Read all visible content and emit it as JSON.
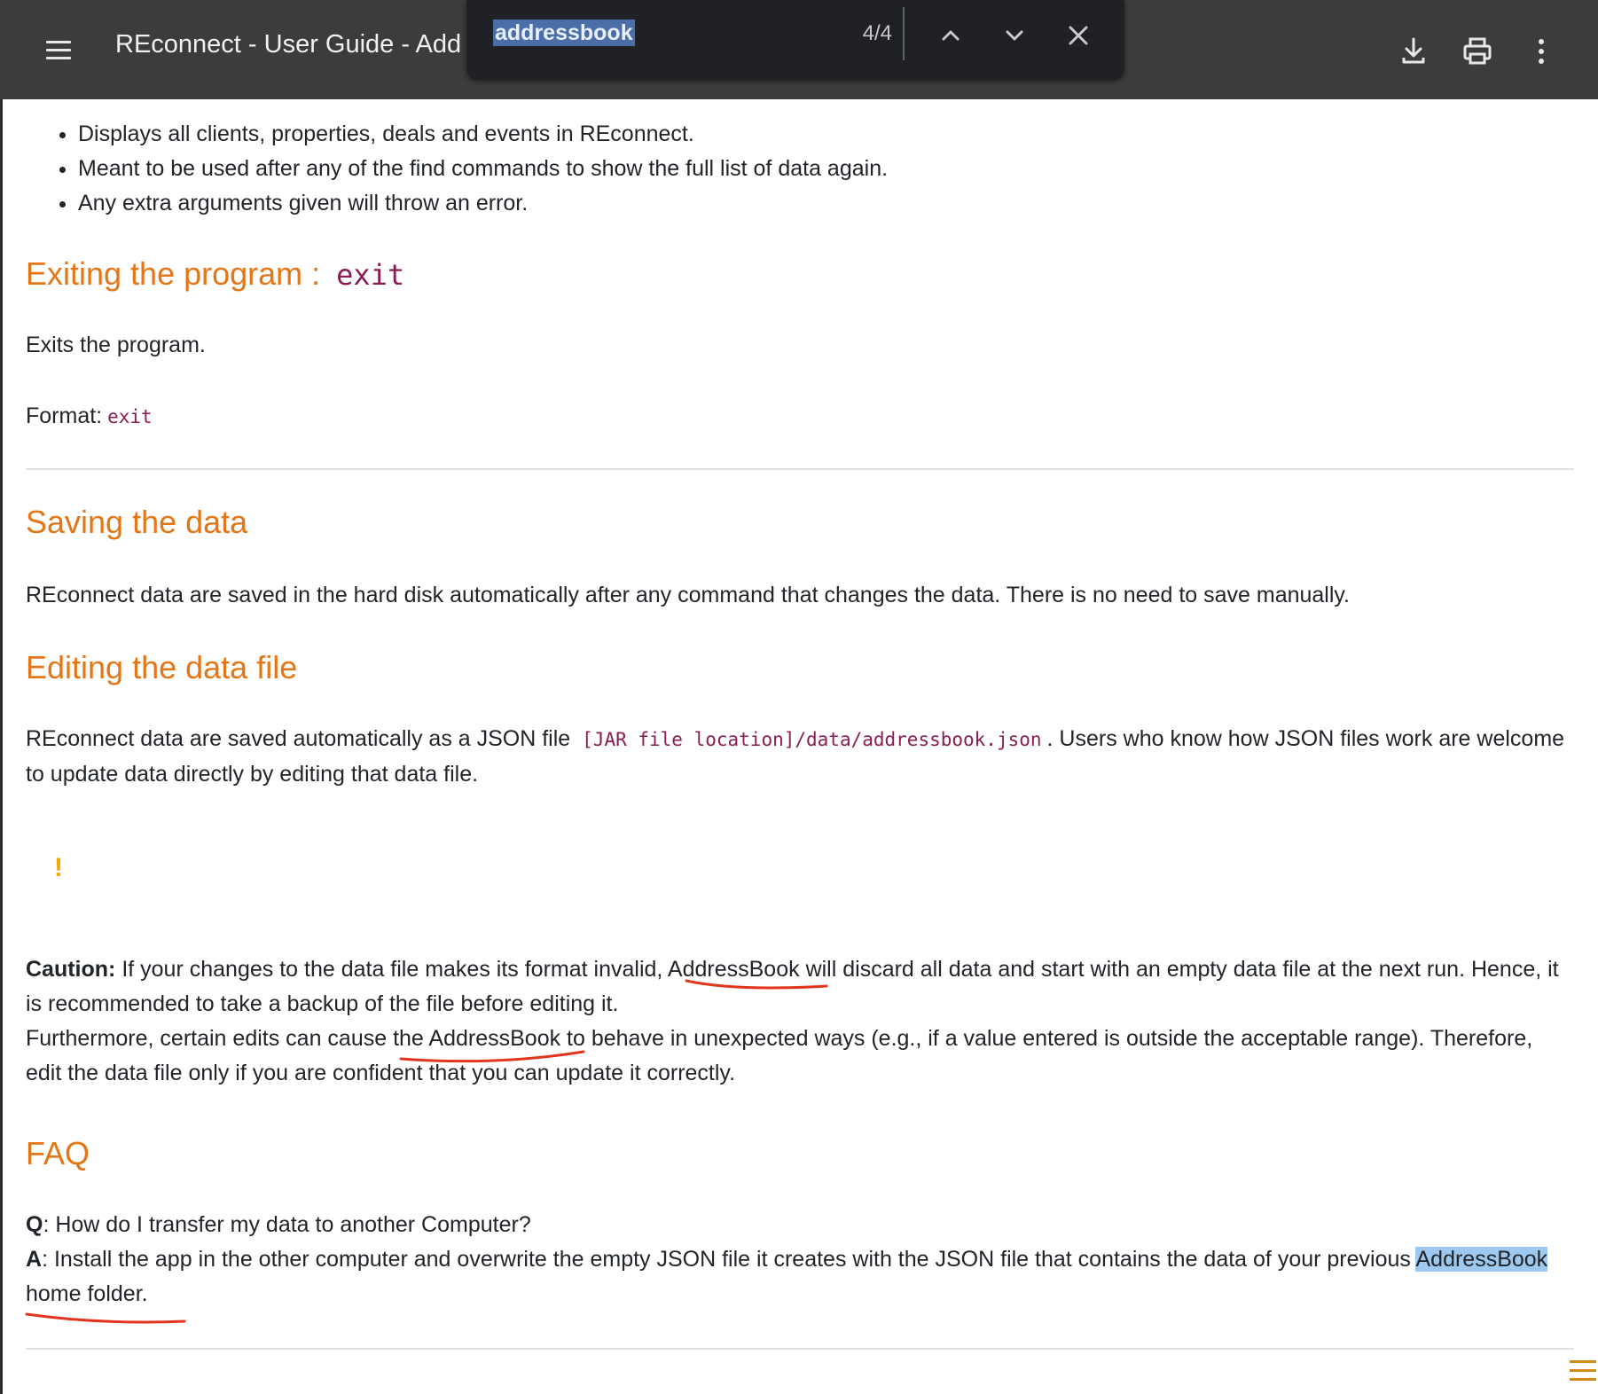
{
  "toolbar": {
    "title": "REconnect - User Guide - Add"
  },
  "find": {
    "query": "addressbook",
    "count": "4/4"
  },
  "content": {
    "bullets": [
      "Displays all clients, properties, deals and events in REconnect.",
      "Meant to be used after any of the find commands to show the full list of data again.",
      "Any extra arguments given will throw an error."
    ],
    "exit_section": {
      "heading": "Exiting the program :",
      "heading_code": "exit",
      "description": "Exits the program.",
      "format_label": "Format:",
      "format_code": "exit"
    },
    "saving_section": {
      "heading": "Saving the data",
      "text": "REconnect data are saved in the hard disk automatically after any command that changes the data. There is no need to save manually."
    },
    "editing_section": {
      "heading": "Editing the data file",
      "text_before": "REconnect data are saved automatically as a JSON file",
      "code": "[JAR file location]/data/addressbook.json",
      "text_after": ". Users who know how JSON files work are welcome to update data directly by editing that data file.",
      "warning_icon": "!",
      "caution_label": "Caution:",
      "caution_part1": " If your changes to the data file makes its format invalid, ",
      "caution_term1": "AddressBook",
      "caution_part2": " will discard all data and start with an empty data file at the next run. Hence, it is recommended to take a backup of the file before editing it.",
      "caution_part3": "Furthermore, certain edits can cause the ",
      "caution_term2": "AddressBook",
      "caution_part4": " to behave in unexpected ways (e.g., if a value entered is outside the acceptable range). Therefore, edit the data file only if you are confident that you can update it correctly."
    },
    "faq_section": {
      "heading": "FAQ",
      "q_label": "Q",
      "q_text": ": How do I transfer my data to another Computer?",
      "a_label": "A",
      "a_text": ": Install the app in the other computer and overwrite the empty JSON file it creates with the JSON file that contains the data of your previous",
      "a_term": "AddressBook",
      "a_end": " home folder."
    }
  },
  "colors": {
    "heading": "#e37616",
    "code": "#8a1d53",
    "annotation_red": "#e0341c",
    "find_highlight": "#9ec9ee"
  },
  "icons": [
    "menu-icon",
    "download-icon",
    "print-icon",
    "more-vert-icon",
    "chevron-up-icon",
    "chevron-down-icon",
    "close-icon",
    "warning-icon"
  ]
}
